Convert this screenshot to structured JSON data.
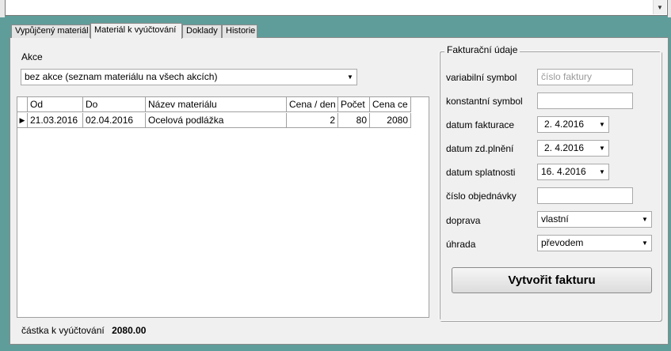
{
  "tabs": [
    {
      "label": "Vypůjčený materiál",
      "active": false
    },
    {
      "label": "Materiál k vyúčtování",
      "active": true
    },
    {
      "label": "Doklady",
      "active": false
    },
    {
      "label": "Historie",
      "active": false
    }
  ],
  "akce": {
    "label": "Akce",
    "selected": "bez akce (seznam materiálu na všech akcích)"
  },
  "grid": {
    "columns": [
      "Od",
      "Do",
      "Název materiálu",
      "Cena / den",
      "Počet",
      "Cena ce"
    ],
    "rows": [
      {
        "od": "21.03.2016",
        "do": "02.04.2016",
        "nazev": "Ocelová podlážka",
        "cena_den": "2",
        "pocet": "80",
        "cena_celkem": "2080"
      }
    ]
  },
  "invoice": {
    "group_title": "Fakturační údaje",
    "variabilni_symbol": {
      "label": "variabilní symbol",
      "placeholder": "číslo faktury"
    },
    "konstantni_symbol": {
      "label": "konstantní symbol",
      "value": ""
    },
    "datum_fakturace": {
      "label": "datum fakturace",
      "value": "2.  4.2016"
    },
    "datum_plneni": {
      "label": "datum zd.plnění",
      "value": "2.  4.2016"
    },
    "datum_splatnosti": {
      "label": "datum splatnosti",
      "value": "16.  4.2016"
    },
    "cislo_objednavky": {
      "label": "číslo objednávky",
      "value": ""
    },
    "doprava": {
      "label": "doprava",
      "value": "vlastní"
    },
    "uhrada": {
      "label": "úhrada",
      "value": "převodem"
    },
    "create_button": "Vytvořit fakturu"
  },
  "total": {
    "label": "částka k vyúčtování",
    "value": "2080.00"
  },
  "icons": {
    "dropdown": "chevron-down-icon",
    "row_pointer": "row-pointer-icon",
    "scroll": "scroll-down-icon"
  }
}
